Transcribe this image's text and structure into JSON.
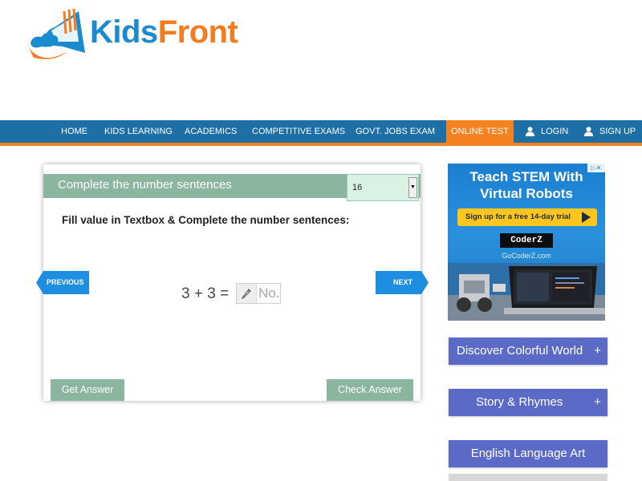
{
  "logo": {
    "part1": "Kids",
    "part2": "Front"
  },
  "nav": {
    "items": [
      "HOME",
      "KIDS LEARNING",
      "ACADEMICS",
      "COMPETITIVE EXAMS",
      "GOVT. JOBS EXAM",
      "ONLINE TEST"
    ],
    "active": "ONLINE TEST",
    "login": "LOGIN",
    "signup": "SIGN UP"
  },
  "quiz": {
    "title": "Complete the number sentences",
    "level": "16",
    "instruction": "Fill value in Textbox & Complete the number sentences:",
    "equation": "3 + 3 =",
    "answer_placeholder": "No.",
    "answer_value": "",
    "previous": "PREVIOUS",
    "next": "NEXT",
    "get_answer": "Get Answer",
    "check_answer": "Check Answer"
  },
  "ad": {
    "headline_line1": "Teach STEM With",
    "headline_line2": "Virtual Robots",
    "cta": "Sign up for a free 14-day trial",
    "brand": "CoderZ",
    "url": "GoCoderZ.com"
  },
  "sidebar": {
    "items": [
      {
        "label": "Discover Colorful World",
        "icon": "+"
      },
      {
        "label": "Story & Rhymes",
        "icon": "+"
      },
      {
        "label": "English Language Art",
        "icon": ""
      }
    ]
  },
  "colors": {
    "nav_bg": "#1d6fa5",
    "accent_orange": "#f58220",
    "quiz_green": "#8cb5a0",
    "sidebar_blue": "#5b6ac7",
    "arrow_blue": "#1e8fe0"
  }
}
